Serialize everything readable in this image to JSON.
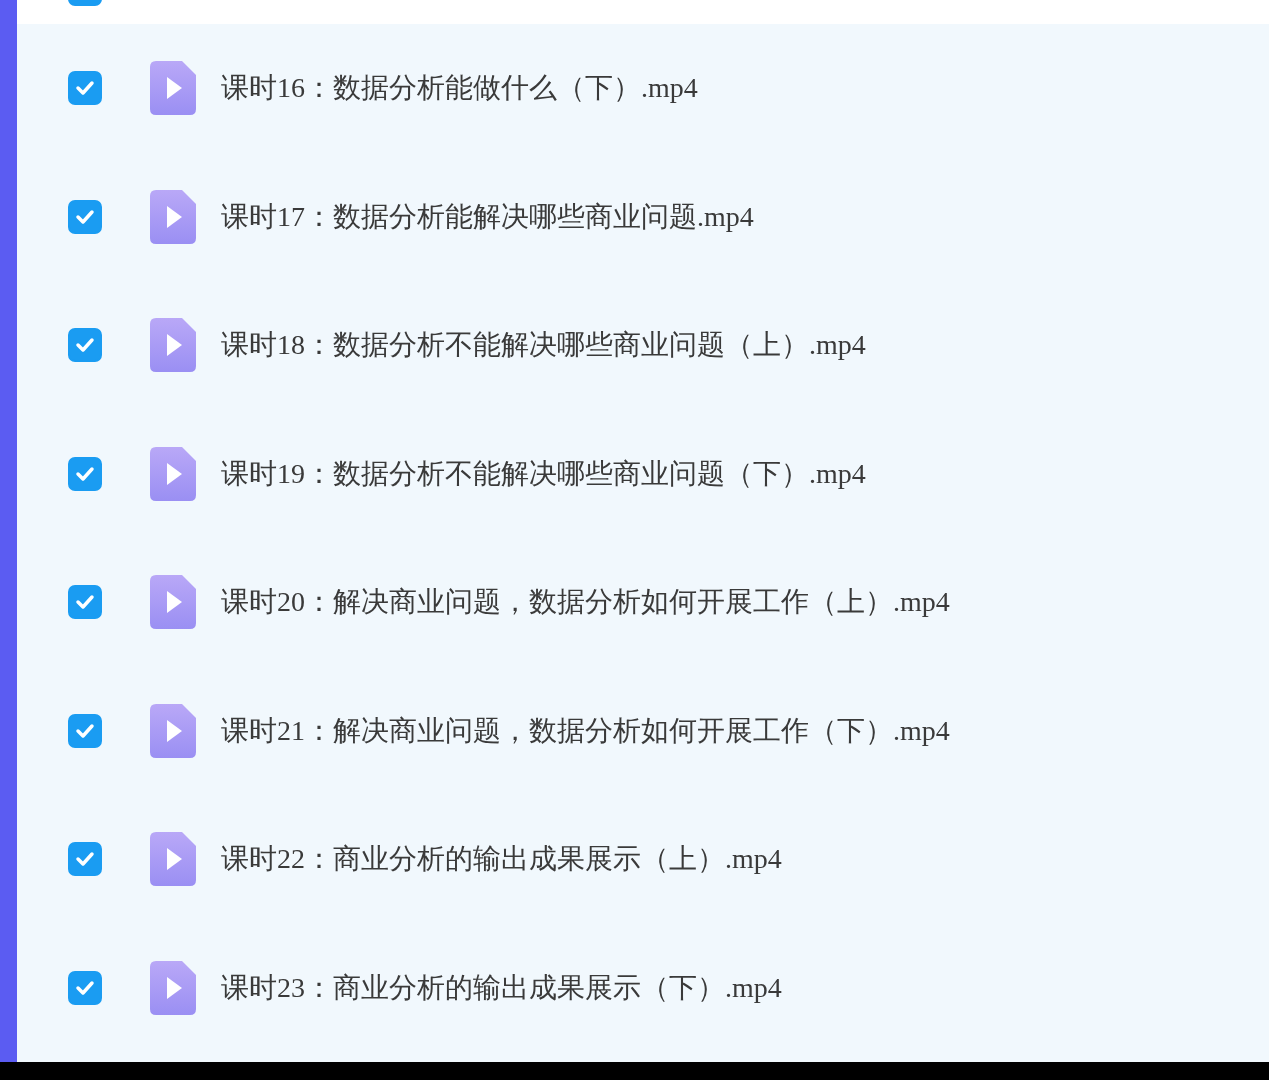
{
  "partial_row": {
    "checked": true
  },
  "files": [
    {
      "name": "课时16：数据分析能做什么（下）.mp4",
      "checked": true
    },
    {
      "name": "课时17：数据分析能解决哪些商业问题.mp4",
      "checked": true
    },
    {
      "name": "课时18：数据分析不能解决哪些商业问题（上）.mp4",
      "checked": true
    },
    {
      "name": "课时19：数据分析不能解决哪些商业问题（下）.mp4",
      "checked": true
    },
    {
      "name": "课时20：解决商业问题，数据分析如何开展工作（上）.mp4",
      "checked": true
    },
    {
      "name": "课时21：解决商业问题，数据分析如何开展工作（下）.mp4",
      "checked": true
    },
    {
      "name": "课时22：商业分析的输出成果展示（上）.mp4",
      "checked": true
    },
    {
      "name": "课时23：商业分析的输出成果展示（下）.mp4",
      "checked": true
    }
  ]
}
